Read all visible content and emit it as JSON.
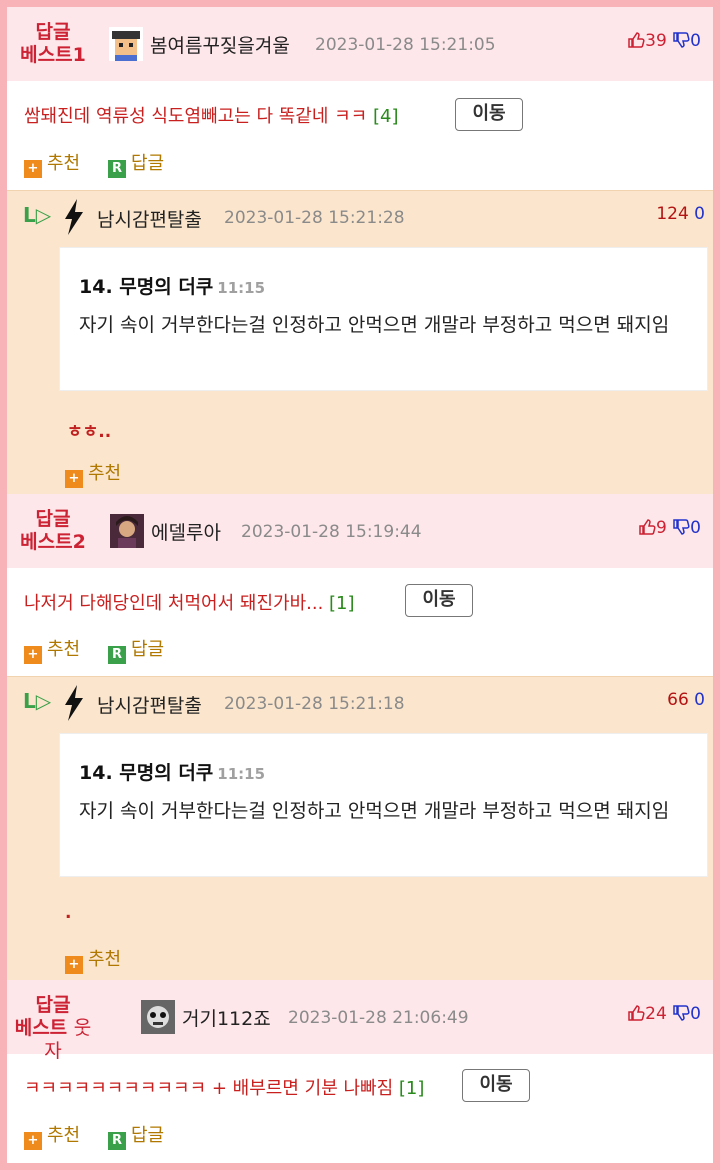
{
  "comments": [
    {
      "best_label_1": "답글",
      "best_label_2": "베스트1",
      "nick": "봄여름꾸짖을겨울",
      "date": "2023-01-28 15:21:05",
      "up": "39",
      "down": "0",
      "text": "쌈돼진데 역류성 식도염빼고는 다 똑같네 ㅋㅋ",
      "count": "[4]",
      "move": "이동",
      "recommend": "추천",
      "reply": "답글",
      "avatar_icon": "pixel-character-avatar"
    },
    {
      "best_label_1": "답글",
      "best_label_2": "베스트2",
      "nick": "에델루아",
      "date": "2023-01-28 15:19:44",
      "up": "9",
      "down": "0",
      "text": "나저거 다해당인데 처먹어서 돼진가바...",
      "count": "[1]",
      "move": "이동",
      "recommend": "추천",
      "reply": "답글",
      "avatar_icon": "photo-avatar"
    },
    {
      "best_label_1": "답글",
      "best_label_2": "베스트",
      "best_label_3": "웃자",
      "nick": "거기112죠",
      "date": "2023-01-28 21:06:49",
      "up": "24",
      "down": "0",
      "text": "ㅋㅋㅋㅋㅋㅋㅋㅋㅋㅋㅋ + 배부르면 기분 나빠짐",
      "count": "[1]",
      "move": "이동",
      "recommend": "추천",
      "reply": "답글",
      "avatar_icon": "photo-avatar"
    }
  ],
  "replies": [
    {
      "nick": "남시감편탈출",
      "date": "2023-01-28 15:21:28",
      "up": "124",
      "down": "0",
      "quote_title": "14. 무명의 더쿠",
      "quote_time": "11:15",
      "quote_text": "자기 속이 거부한다는걸 인정하고 안먹으면 개말라 부정하고 먹으면 돼지임",
      "text": "ㅎㅎ..",
      "recommend": "추천"
    },
    {
      "nick": "남시감편탈출",
      "date": "2023-01-28 15:21:18",
      "up": "66",
      "down": "0",
      "quote_title": "14. 무명의 더쿠",
      "quote_time": "11:15",
      "quote_text": "자기 속이 거부한다는걸 인정하고 안먹으면 개말라 부정하고 먹으면 돼지임",
      "text": ".",
      "recommend": "추천"
    }
  ],
  "colors": {
    "border": "#f7b3b8",
    "best_bg": "#fde7ea",
    "reply_bg": "#fbe6cd",
    "red": "#cc2233",
    "blue": "#2233cc",
    "green": "#3aa04a",
    "orange": "#ef8b1c"
  }
}
